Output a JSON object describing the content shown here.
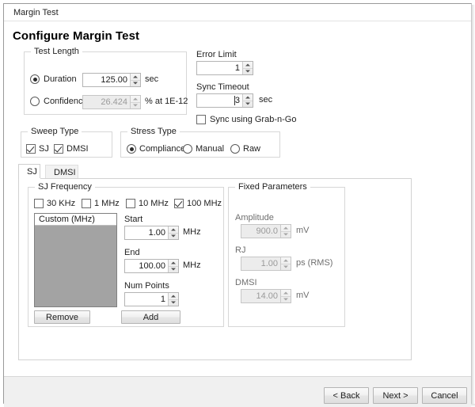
{
  "window": {
    "title": "Margin Test",
    "heading": "Configure Margin Test"
  },
  "test_length": {
    "legend": "Test Length",
    "duration": {
      "label": "Duration",
      "selected": true,
      "value": "125.00",
      "unit": "sec"
    },
    "confidence": {
      "label": "Confidence",
      "selected": false,
      "value": "26.424",
      "unit": "% at 1E-12",
      "disabled": true
    }
  },
  "error_limit": {
    "label": "Error Limit",
    "value": "1"
  },
  "sync_timeout": {
    "label": "Sync Timeout",
    "value": "3",
    "unit": "sec"
  },
  "sync_grab_n_go": {
    "label": "Sync using Grab-n-Go",
    "checked": false
  },
  "sweep_type": {
    "legend": "Sweep Type",
    "options": [
      {
        "label": "SJ",
        "checked": true
      },
      {
        "label": "DMSI",
        "checked": true
      }
    ]
  },
  "stress_type": {
    "legend": "Stress Type",
    "options": [
      {
        "label": "Compliance",
        "selected": true
      },
      {
        "label": "Manual",
        "selected": false
      },
      {
        "label": "Raw",
        "selected": false
      }
    ]
  },
  "tabs": [
    {
      "label": "SJ",
      "active": true
    },
    {
      "label": "DMSI",
      "active": false
    }
  ],
  "sj_frequency": {
    "legend": "SJ Frequency",
    "checkboxes": [
      {
        "label": "30 KHz",
        "checked": false
      },
      {
        "label": "1 MHz",
        "checked": false
      },
      {
        "label": "10 MHz",
        "checked": false
      },
      {
        "label": "100 MHz",
        "checked": true
      }
    ],
    "listbox": {
      "header": "Custom (MHz)",
      "items": []
    },
    "start": {
      "label": "Start",
      "value": "1.00",
      "unit": "MHz"
    },
    "end": {
      "label": "End",
      "value": "100.00",
      "unit": "MHz"
    },
    "num_points": {
      "label": "Num Points",
      "value": "1",
      "unit": ""
    },
    "remove_button": "Remove",
    "add_button": "Add"
  },
  "fixed_parameters": {
    "legend": "Fixed Parameters",
    "amplitude": {
      "label": "Amplitude",
      "value": "900.0",
      "unit": "mV",
      "disabled": true
    },
    "rj": {
      "label": "RJ",
      "value": "1.00",
      "unit": "ps (RMS)",
      "disabled": true
    },
    "dmsi": {
      "label": "DMSI",
      "value": "14.00",
      "unit": "mV",
      "disabled": true
    }
  },
  "footer": {
    "back": "< Back",
    "next": "Next >",
    "cancel": "Cancel"
  },
  "colors": {
    "window_bg": "#ffffff",
    "footer_bg": "#f0f0f0",
    "group_border": "#d7d7d7",
    "listbox_fill": "#a3a3a3",
    "disabled_field": "#ececec"
  }
}
